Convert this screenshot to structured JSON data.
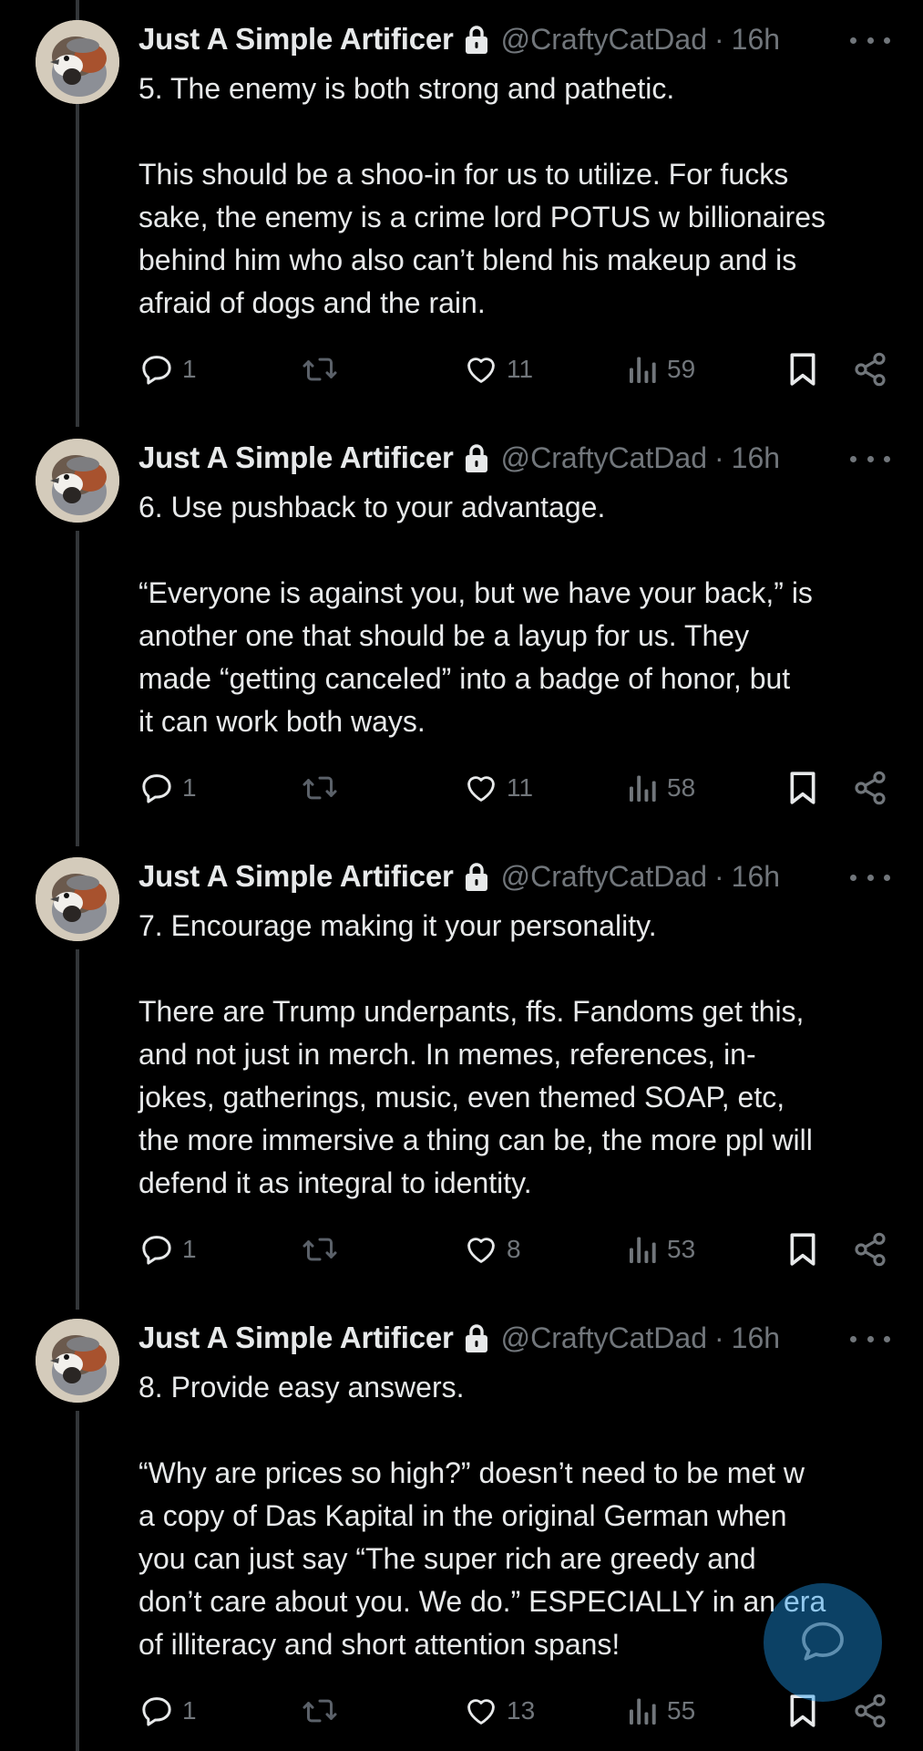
{
  "author": {
    "display_name": "Just A Simple Artificer",
    "handle": "@CraftyCatDad",
    "separator": "·",
    "time": "16h"
  },
  "icons": {
    "lock": "lock-icon",
    "more": "more-icon",
    "reply": "reply-icon",
    "retweet": "retweet-icon",
    "like": "heart-icon",
    "views": "views-icon",
    "bookmark": "bookmark-icon",
    "share": "share-icon",
    "compose": "compose-icon"
  },
  "colors": {
    "background": "#000000",
    "text": "#e7e9ea",
    "muted": "#71767b",
    "thread_line": "#333639",
    "accent": "#1d9bf0"
  },
  "tweets": [
    {
      "heading": "5. The enemy is both strong and pathetic.",
      "body": "This should be a shoo-in for us to utilize. For fucks\nsake, the enemy is a crime lord POTUS w billionaires\nbehind him who also can’t blend his makeup and is\nafraid of dogs and the rain.",
      "replies": "1",
      "retweets": "",
      "likes": "11",
      "views": "59"
    },
    {
      "heading": "6. Use pushback to your advantage.",
      "body": "“Everyone is against you, but we have your back,” is\nanother one that should be a layup for us. They\nmade “getting canceled” into a badge of honor, but\nit can work both ways.",
      "replies": "1",
      "retweets": "",
      "likes": "11",
      "views": "58"
    },
    {
      "heading": "7. Encourage making it your personality.",
      "body": "There are Trump underpants, ffs. Fandoms get this,\nand not just in merch. In memes, references, in-\njokes, gatherings, music, even themed SOAP, etc,\nthe more immersive a thing can be, the more ppl will\ndefend it as integral to identity.",
      "replies": "1",
      "retweets": "",
      "likes": "8",
      "views": "53"
    },
    {
      "heading": "8. Provide easy answers.",
      "body": "“Why are prices so high?” doesn’t need to be met w\na copy of Das Kapital in the original German when\nyou can just say “The super rich are greedy and\ndon’t care about you. We do.” ESPECIALLY in an era\nof illiteracy and short attention spans!",
      "replies": "1",
      "retweets": "",
      "likes": "13",
      "views": "55"
    }
  ]
}
